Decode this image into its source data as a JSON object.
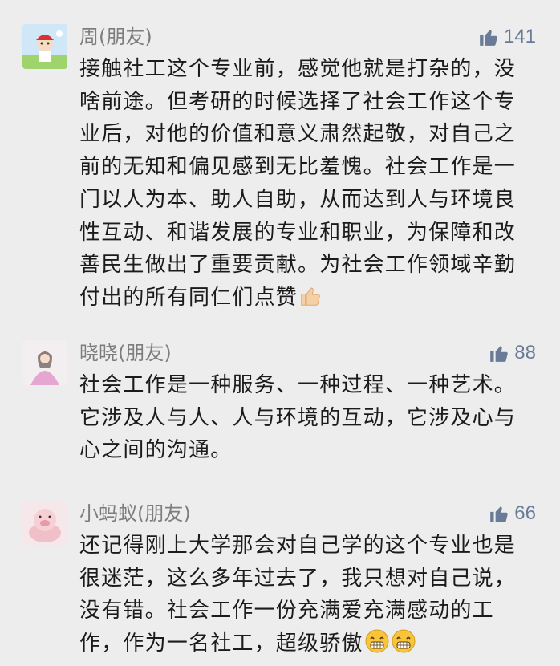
{
  "colors": {
    "background": "#ededed",
    "name": "#7d7d7d",
    "like": "#6a7b98",
    "text": "#1b1b1b"
  },
  "comments": [
    {
      "name": "周(朋友)",
      "likes": "141",
      "text": "接触社工这个专业前，感觉他就是打杂的，没啥前途。但考研的时候选择了社会工作这个专业后，对他的价值和意义肃然起敬，对自己之前的无知和偏见感到无比羞愧。社会工作是一门以人为本、助人自助，从而达到人与环境良性互动、和谐发展的专业和职业，为保障和改善民生做出了重要贡献。为社会工作领域辛勤付出的所有同仁们点赞",
      "emoji": [
        "thumbs-up-emoji"
      ]
    },
    {
      "name": "晓晓(朋友)",
      "likes": "88",
      "text": "社会工作是一种服务、一种过程、一种艺术。它涉及人与人、人与环境的互动，它涉及心与心之间的沟通。",
      "emoji": []
    },
    {
      "name": "小蚂蚁(朋友)",
      "likes": "66",
      "text": "还记得刚上大学那会对自己学的这个专业也是很迷茫，这么多年过去了，我只想对自己说，没有错。社会工作一份充满爱充满感动的工作，作为一名社工，超级骄傲",
      "emoji": [
        "grinning-emoji",
        "grinning-emoji"
      ]
    }
  ]
}
